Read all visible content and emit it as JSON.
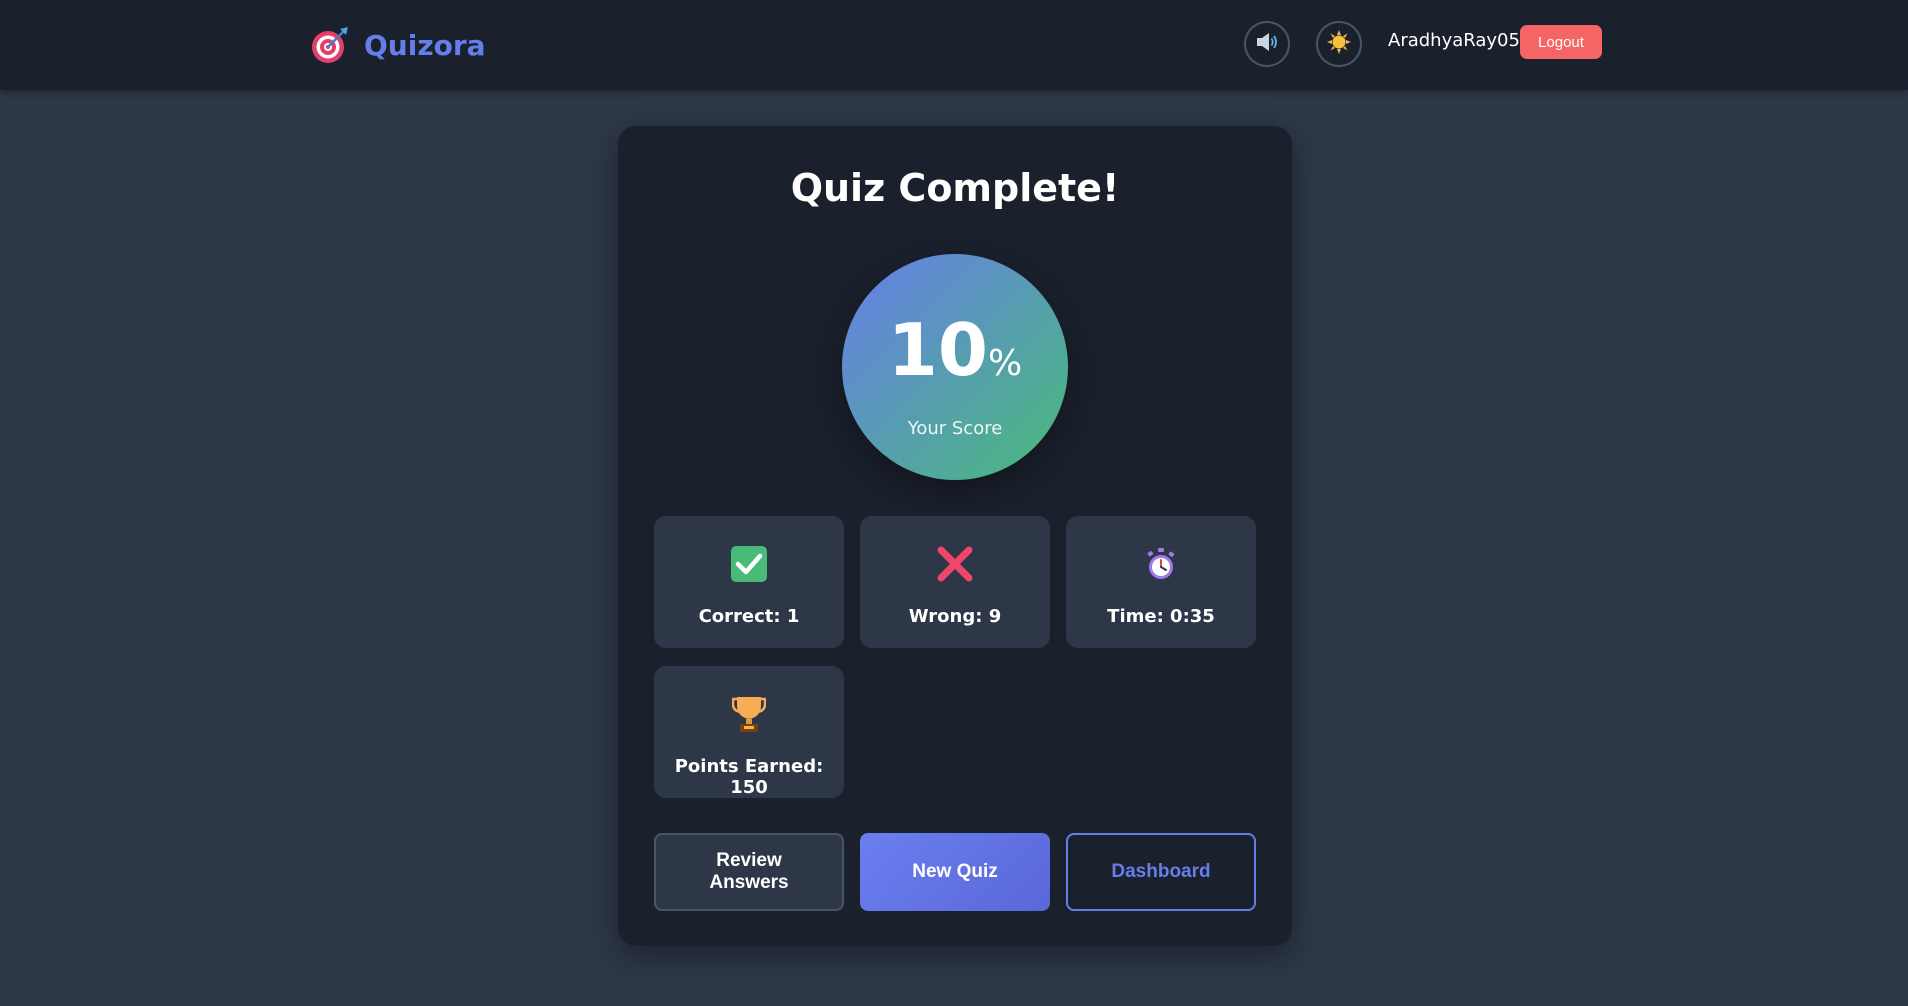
{
  "navbar": {
    "brand_name": "Quizora",
    "brand_icon": "target-dart-icon",
    "sound_icon": "speaker-icon",
    "theme_icon": "sun-icon",
    "username": "AradhyaRay05",
    "logout_label": "Logout"
  },
  "result": {
    "title": "Quiz Complete!",
    "score_value": "10",
    "score_unit": "%",
    "score_label": "Your Score",
    "stats": [
      {
        "icon": "check-mark-icon",
        "label": "Correct: 1"
      },
      {
        "icon": "cross-mark-icon",
        "label": "Wrong: 9"
      },
      {
        "icon": "stopwatch-icon",
        "label": "Time: 0:35"
      },
      {
        "icon": "trophy-icon",
        "label": "Points Earned: 150"
      }
    ],
    "actions": {
      "review_label": "Review Answers",
      "new_quiz_label": "New Quiz",
      "dashboard_label": "Dashboard"
    }
  },
  "colors": {
    "accent": "#667eea",
    "logout": "#f56565",
    "success": "#48bb78",
    "background": "#2d3748",
    "card": "#1a202c"
  }
}
